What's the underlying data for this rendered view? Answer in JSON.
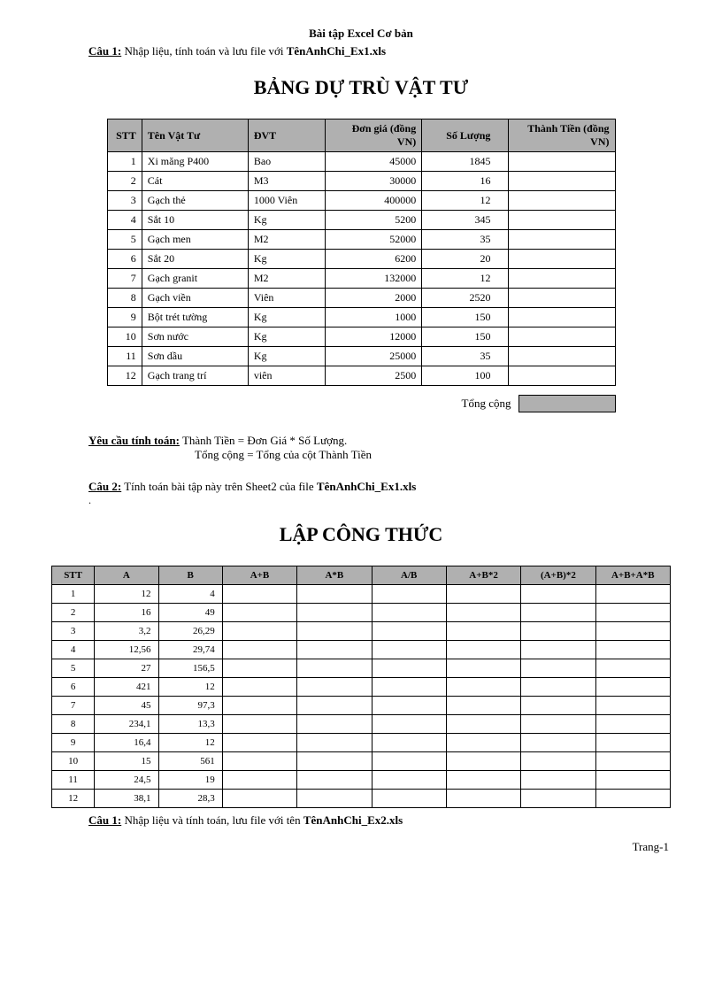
{
  "header": {
    "title": "Bài tập Excel Cơ bản",
    "cau1_label": "Câu 1:",
    "cau1_text": "Nhập liệu, tính toán và lưu file với",
    "cau1_file": "TênAnhChi_Ex1.xls"
  },
  "main_title1": "BẢNG DỰ TRÙ VẬT TƯ",
  "table1": {
    "headers": {
      "stt": "STT",
      "ten": "Tên Vật Tư",
      "dvt": "ĐVT",
      "dongia": "Đơn giá (đồng VN)",
      "soluong": "Số Lượng",
      "thanhtien": "Thành Tiền (đồng VN)"
    },
    "rows": [
      {
        "stt": "1",
        "ten": "Xi măng P400",
        "dvt": "Bao",
        "dongia": "45000",
        "soluong": "1845",
        "thanhtien": ""
      },
      {
        "stt": "2",
        "ten": "Cát",
        "dvt": "M3",
        "dongia": "30000",
        "soluong": "16",
        "thanhtien": ""
      },
      {
        "stt": "3",
        "ten": "Gạch thẻ",
        "dvt": "1000 Viên",
        "dongia": "400000",
        "soluong": "12",
        "thanhtien": ""
      },
      {
        "stt": "4",
        "ten": "Sắt 10",
        "dvt": "Kg",
        "dongia": "5200",
        "soluong": "345",
        "thanhtien": ""
      },
      {
        "stt": "5",
        "ten": "Gạch men",
        "dvt": "M2",
        "dongia": "52000",
        "soluong": "35",
        "thanhtien": ""
      },
      {
        "stt": "6",
        "ten": "Sắt 20",
        "dvt": "Kg",
        "dongia": "6200",
        "soluong": "20",
        "thanhtien": ""
      },
      {
        "stt": "7",
        "ten": "Gạch granit",
        "dvt": "M2",
        "dongia": "132000",
        "soluong": "12",
        "thanhtien": ""
      },
      {
        "stt": "8",
        "ten": "Gạch viền",
        "dvt": "Viên",
        "dongia": "2000",
        "soluong": "2520",
        "thanhtien": ""
      },
      {
        "stt": "9",
        "ten": "Bột trét tường",
        "dvt": "Kg",
        "dongia": "1000",
        "soluong": "150",
        "thanhtien": ""
      },
      {
        "stt": "10",
        "ten": "Sơn nước",
        "dvt": "Kg",
        "dongia": "12000",
        "soluong": "150",
        "thanhtien": ""
      },
      {
        "stt": "11",
        "ten": "Sơn dầu",
        "dvt": "Kg",
        "dongia": "25000",
        "soluong": "35",
        "thanhtien": ""
      },
      {
        "stt": "12",
        "ten": "Gạch trang trí",
        "dvt": "viên",
        "dongia": "2500",
        "soluong": "100",
        "thanhtien": ""
      }
    ]
  },
  "total_label": "Tổng cộng",
  "calc_req": {
    "label": "Yêu cầu tính toán:",
    "line1": "Thành Tiền = Đơn Giá * Số Lượng.",
    "line2": "Tổng cộng = Tổng của cột Thành Tiền"
  },
  "cau2": {
    "label": "Câu 2:",
    "text": "Tính toán bài tập này trên Sheet2 của file",
    "file": "TênAnhChi_Ex1.xls"
  },
  "main_title2": "LẬP CÔNG THỨC",
  "table2": {
    "headers": {
      "stt": "STT",
      "a": "A",
      "b": "B",
      "apb": "A+B",
      "amb": "A*B",
      "adb": "A/B",
      "apb2": "A+B*2",
      "apbt2": "(A+B)*2",
      "apbab": "A+B+A*B"
    },
    "rows": [
      {
        "stt": "1",
        "a": "12",
        "b": "4"
      },
      {
        "stt": "2",
        "a": "16",
        "b": "49"
      },
      {
        "stt": "3",
        "a": "3,2",
        "b": "26,29"
      },
      {
        "stt": "4",
        "a": "12,56",
        "b": "29,74"
      },
      {
        "stt": "5",
        "a": "27",
        "b": "156,5"
      },
      {
        "stt": "6",
        "a": "421",
        "b": "12"
      },
      {
        "stt": "7",
        "a": "45",
        "b": "97,3"
      },
      {
        "stt": "8",
        "a": "234,1",
        "b": "13,3"
      },
      {
        "stt": "9",
        "a": "16,4",
        "b": "12"
      },
      {
        "stt": "10",
        "a": "15",
        "b": "561"
      },
      {
        "stt": "11",
        "a": "24,5",
        "b": "19"
      },
      {
        "stt": "12",
        "a": "38,1",
        "b": "28,3"
      }
    ]
  },
  "footer_cau": {
    "label": "Câu 1:",
    "text": "Nhập liệu và tính toán, lưu file với tên",
    "file": "TênAnhChi_Ex2.xls"
  },
  "page_num": "Trang-1"
}
